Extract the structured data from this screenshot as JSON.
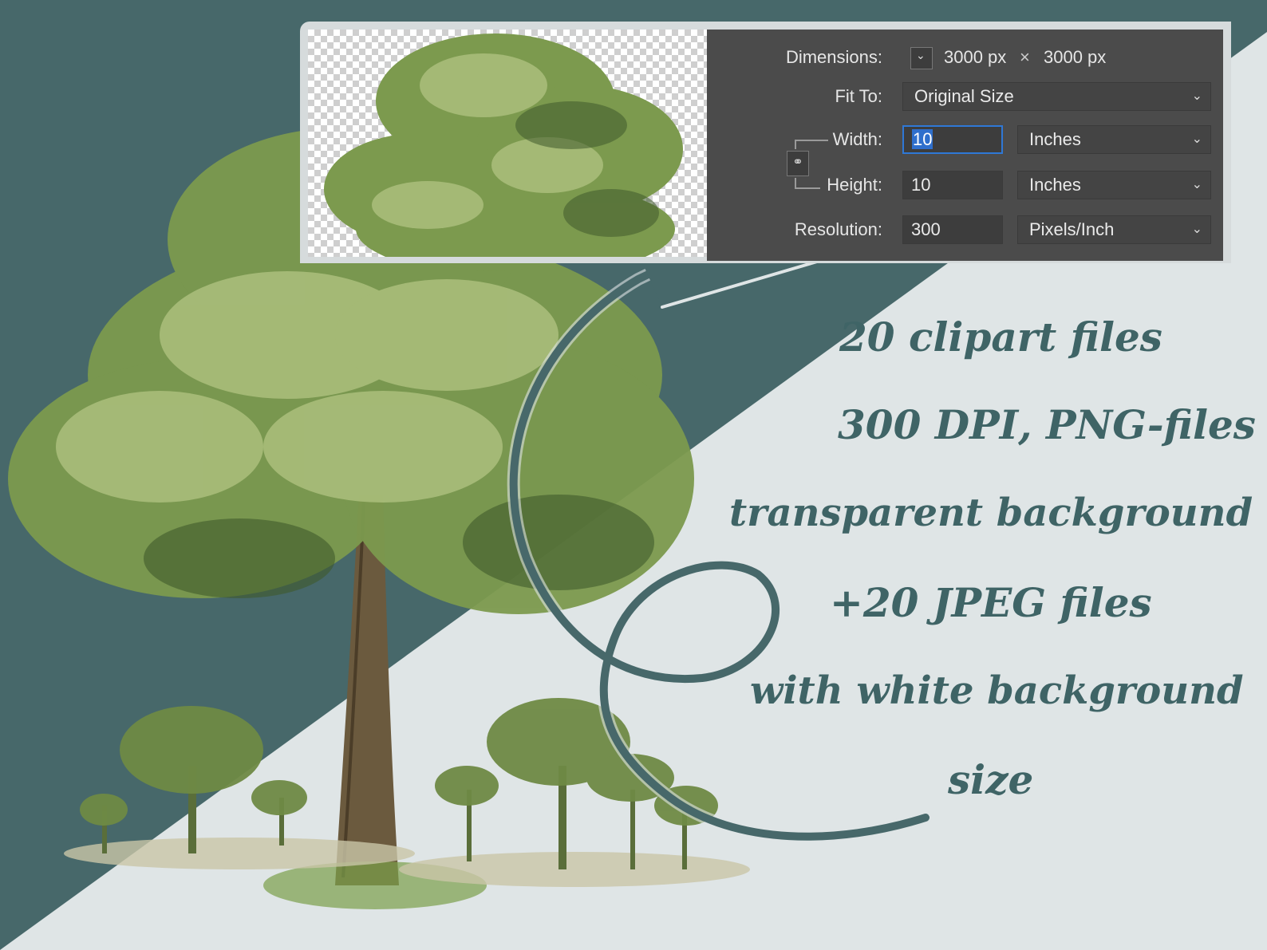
{
  "dialog": {
    "dimensions_label": "Dimensions:",
    "dimensions_width": "3000 px",
    "dimensions_times": "×",
    "dimensions_height": "3000 px",
    "fit_to_label": "Fit To:",
    "fit_to_value": "Original Size",
    "width_label": "Width:",
    "width_value": "10",
    "width_unit": "Inches",
    "height_label": "Height:",
    "height_value": "10",
    "height_unit": "Inches",
    "resolution_label": "Resolution:",
    "resolution_value": "300",
    "resolution_unit": "Pixels/Inch"
  },
  "promo": {
    "line1": "20  clipart  files",
    "line2": "300 DPI, PNG-files",
    "line3": "transparent background",
    "line4": "+20 JPEG files",
    "line5": "with white background",
    "line6": "size"
  },
  "colors": {
    "dark_teal": "#47686a",
    "light_gray": "#dfe5e6",
    "text_teal": "#3f6466",
    "dialog_bg": "#4b4b4b",
    "focus_blue": "#2f78d6"
  },
  "icons": [
    "chevron-down-icon",
    "link-chain-icon",
    "swirl-arrow-icon",
    "palm-tree-icon"
  ]
}
